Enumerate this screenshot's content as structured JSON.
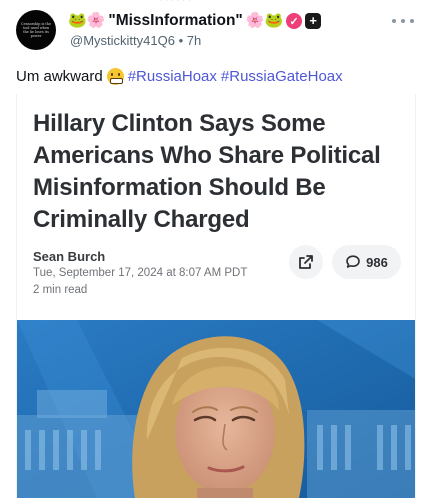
{
  "post": {
    "avatar_text": "Censorship is the tool used when the lie loses its power",
    "display_name": "\"MissInformation\"",
    "name_emoji_prefix": "🐸🌸",
    "name_emoji_suffix": "🌸🐸",
    "handle": "@Mystickitty41Q6",
    "separator": "•",
    "time": "7h",
    "text": "Um awkward",
    "hashtags": [
      "#RussiaHoax",
      "#RussiaGateHoax"
    ]
  },
  "article": {
    "headline": "Hillary Clinton Says Some Americans Who Share Political Misinformation Should Be Criminally Charged",
    "author": "Sean Burch",
    "date": "Tue, September 17, 2024 at 8:07 AM PDT",
    "read_time": "2 min read",
    "comment_count": "986"
  },
  "icons": {
    "more": "more-horizontal-icon",
    "share": "external-link-icon",
    "comment": "comment-bubble-icon",
    "verified": "pink-badge-icon",
    "plus": "plus-square-icon"
  },
  "colors": {
    "hashtag": "#4f57d6",
    "muted": "#536471",
    "photo_background": "#1f6bb0"
  }
}
